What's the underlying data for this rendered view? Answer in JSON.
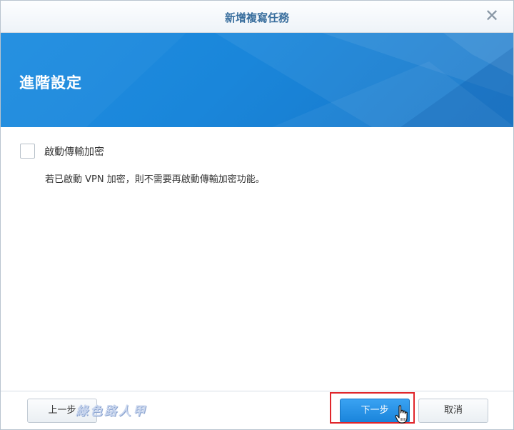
{
  "dialog": {
    "title": "新增複寫任務",
    "close_icon": "close-icon"
  },
  "banner": {
    "title": "進階設定"
  },
  "content": {
    "encryption_checkbox": {
      "label": "啟動傳輸加密",
      "checked": false
    },
    "hint": "若已啟動 VPN 加密，則不需要再啟動傳輸加密功能。"
  },
  "footer": {
    "prev_label": "上一步",
    "next_label": "下一步",
    "cancel_label": "取消"
  },
  "watermark": "綠色路人甲",
  "colors": {
    "banner": "#1a86da",
    "primary_button": "#1a84db",
    "highlight": "#e0262b",
    "title": "#3a6f9e"
  }
}
